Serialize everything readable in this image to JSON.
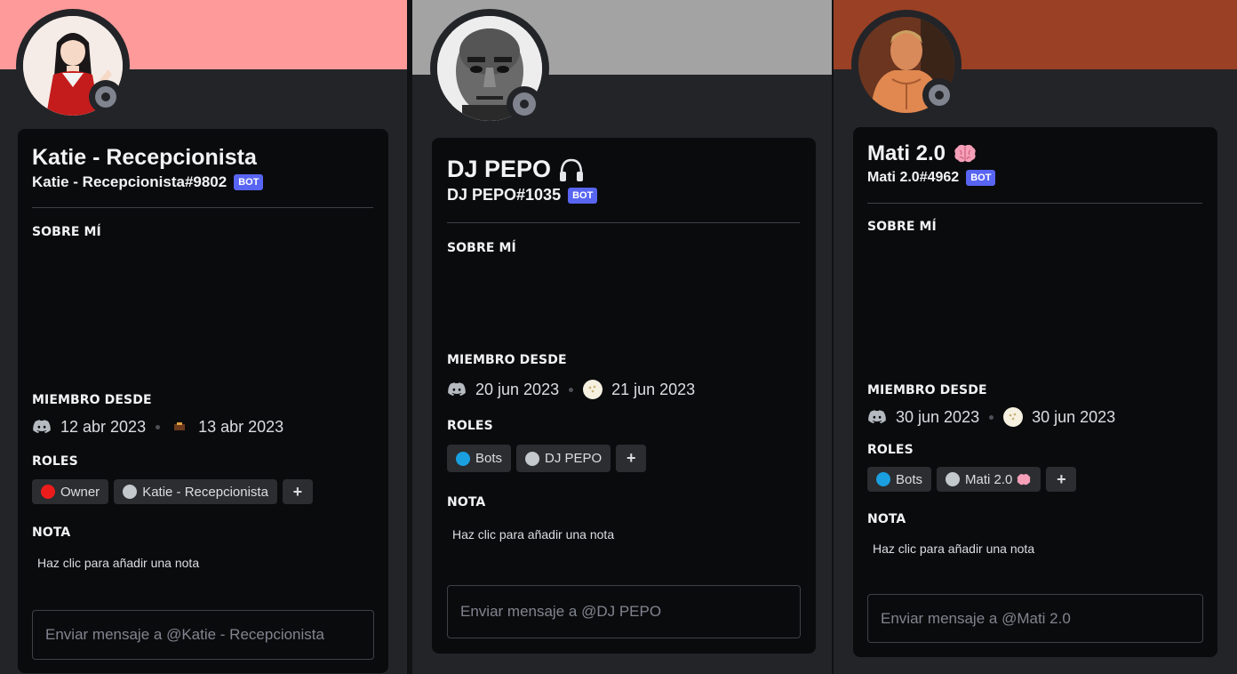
{
  "profiles": [
    {
      "display_name": "Katie - Recepcionista",
      "username": "Katie - Recepcionista#9802",
      "badge": "BOT",
      "about_title": "SOBRE MÍ",
      "member_since_title": "MIEMBRO DESDE",
      "discord_since": "12 abr 2023",
      "server_since": "13 abr 2023",
      "roles_title": "ROLES",
      "roles": [
        {
          "name": "Owner",
          "color": "#ed1c1c"
        },
        {
          "name": "Katie - Recepcionista",
          "color": "#c4c9ce"
        }
      ],
      "add_role": "+",
      "note_title": "NOTA",
      "note_placeholder": "Haz clic para añadir una nota",
      "message_placeholder": "Enviar mensaje a @Katie - Recepcionista",
      "banner_color": "#ff9a9a",
      "avatar_icon": "anime-girl-avatar"
    },
    {
      "display_name": "DJ PEPO",
      "name_emoji": "🎧",
      "username": "DJ PEPO#1035",
      "badge": "BOT",
      "about_title": "SOBRE MÍ",
      "member_since_title": "MIEMBRO DESDE",
      "discord_since": "20 jun 2023",
      "server_since": "21 jun 2023",
      "roles_title": "ROLES",
      "roles": [
        {
          "name": "Bots",
          "color": "#1a9fe0"
        },
        {
          "name": "DJ PEPO",
          "color": "#c4c9ce"
        }
      ],
      "add_role": "+",
      "note_title": "NOTA",
      "note_placeholder": "Haz clic para añadir una nota",
      "message_placeholder": "Enviar mensaje a @DJ PEPO",
      "banner_color": "#a3a3a3",
      "avatar_icon": "bald-man-avatar"
    },
    {
      "display_name": "Mati 2.0",
      "name_emoji": "🧠",
      "username": "Mati 2.0#4962",
      "badge": "BOT",
      "about_title": "SOBRE MÍ",
      "member_since_title": "MIEMBRO DESDE",
      "discord_since": "30 jun 2023",
      "server_since": "30 jun 2023",
      "roles_title": "ROLES",
      "roles": [
        {
          "name": "Bots",
          "color": "#1a9fe0"
        },
        {
          "name": "Mati 2.0",
          "color": "#c4c9ce",
          "emoji": "🧠"
        }
      ],
      "add_role": "+",
      "note_title": "NOTA",
      "note_placeholder": "Haz clic para añadir una nota",
      "message_placeholder": "Enviar mensaje a @Mati 2.0",
      "banner_color": "#9a4024",
      "avatar_icon": "muscular-man-avatar"
    }
  ]
}
